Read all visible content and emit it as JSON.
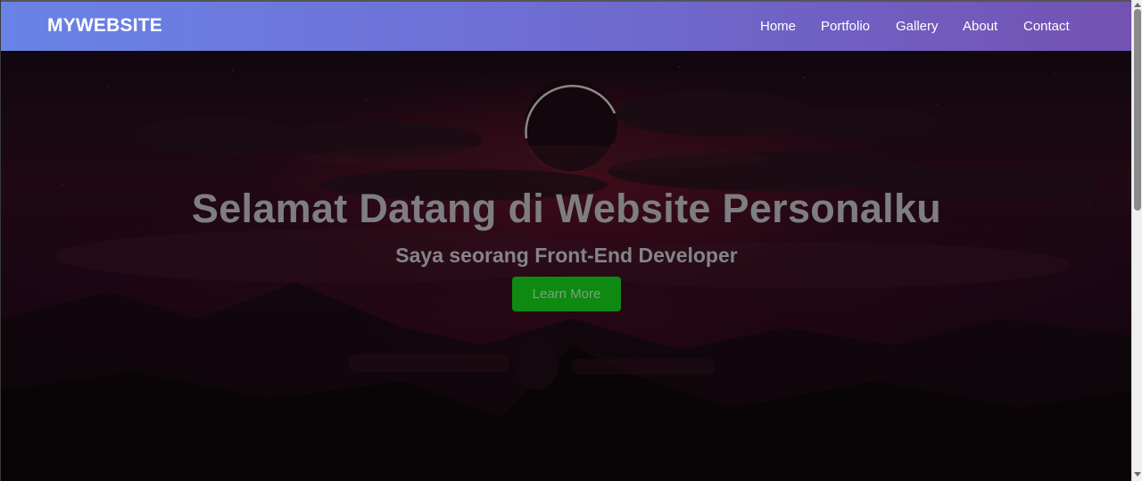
{
  "navbar": {
    "brand": "MYWEBSITE",
    "links": [
      {
        "label": "Home"
      },
      {
        "label": "Portfolio"
      },
      {
        "label": "Gallery"
      },
      {
        "label": "About"
      },
      {
        "label": "Contact"
      }
    ],
    "gradient_colors": [
      "#6a83e6",
      "#7352b2"
    ]
  },
  "hero": {
    "title": "Selamat Datang di Website Personalku",
    "subtitle": "Saya seorang Front-End Developer",
    "button_label": "Learn More",
    "button_color": "#0e8a12",
    "background_image": "eclipse-over-clouds-landscape"
  },
  "scrollbar": {
    "thumb_color": "#8a8a8a",
    "track_color": "#f0f0f0"
  }
}
